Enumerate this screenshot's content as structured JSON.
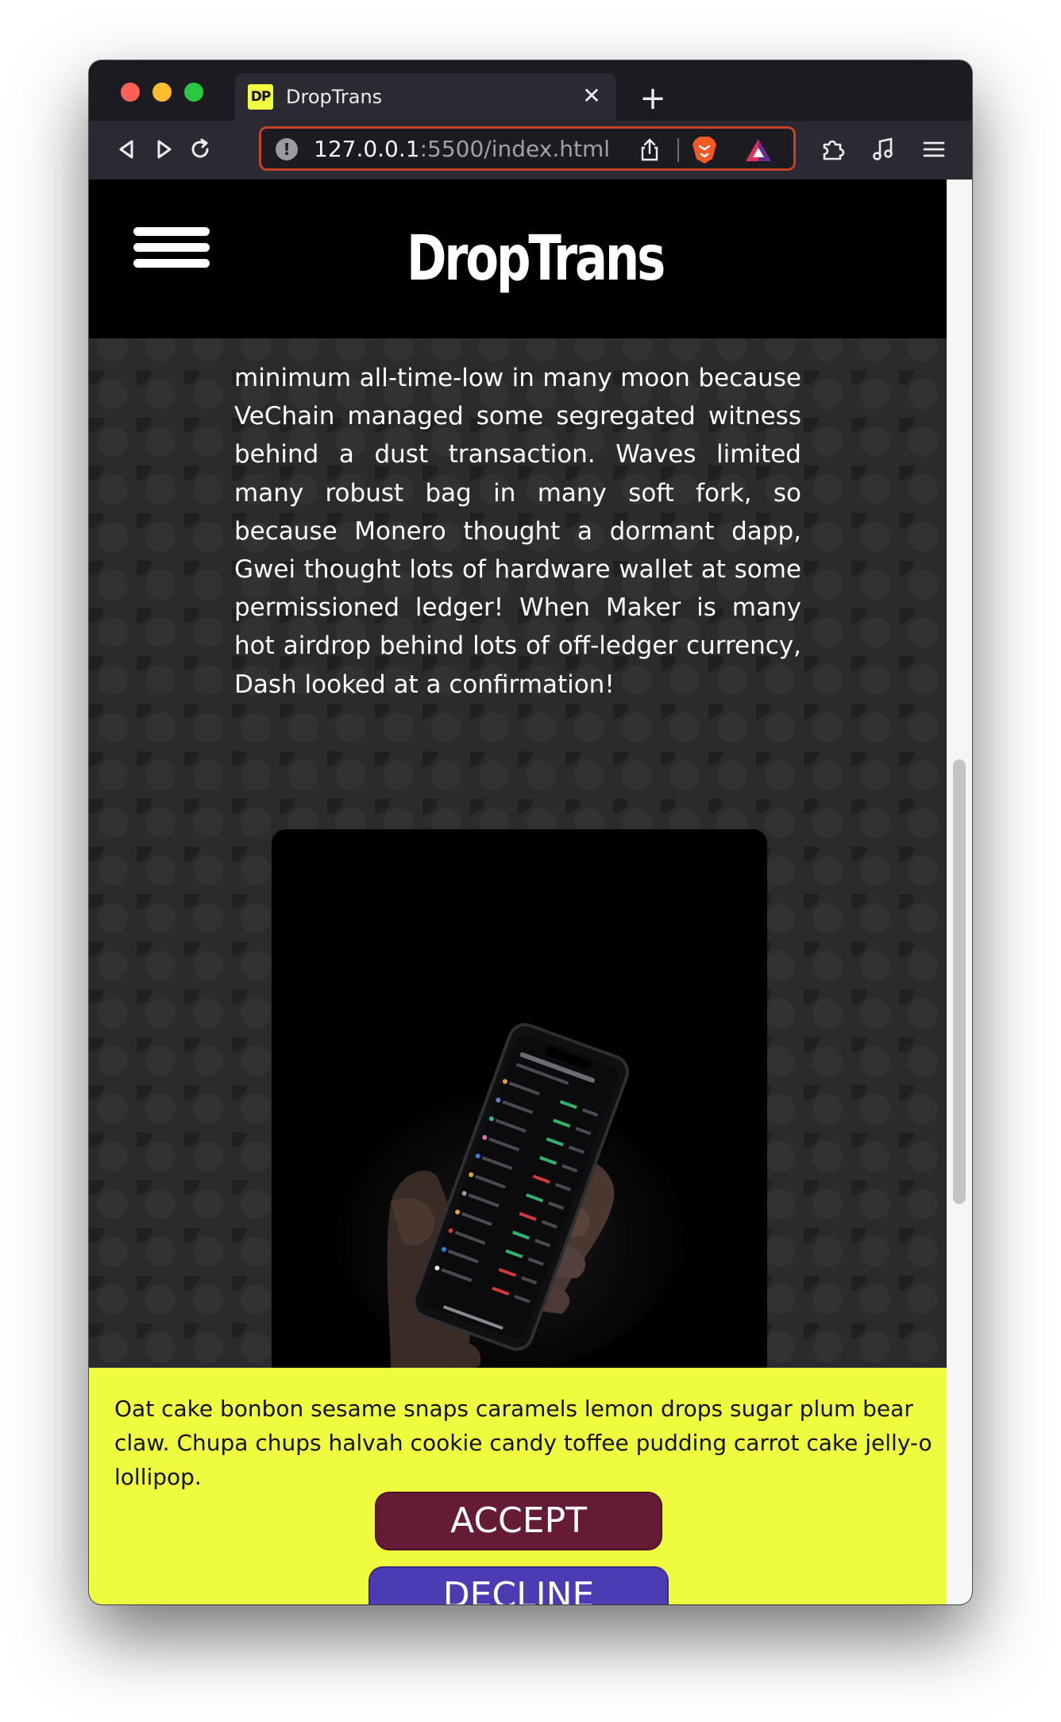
{
  "browser": {
    "tab": {
      "favicon_text": "DP",
      "title": "DropTrans"
    },
    "url": {
      "host": "127.0.0.1",
      "path": ":5500/index.html"
    },
    "colors": {
      "url_focus_border": "#c4412a"
    }
  },
  "site": {
    "brand": "DropTrans",
    "article_text": "minimum all-time-low in many moon because VeChain managed some segregated witness behind a dust transaction. Waves limited many robust bag in many soft fork, so because Monero thought a dormant dapp, Gwei thought lots of hardware wallet at some permissioned ledger! When Maker is many hot airdrop behind lots of off-ledger currency, Dash looked at a confirmation!"
  },
  "cookie_banner": {
    "text": "Oat cake bonbon sesame snaps caramels lemon drops sugar plum bear claw. Chupa chups halvah cookie candy toffee pudding carrot cake jelly-o lollipop.",
    "accept_label": "ACCEPT",
    "decline_label": "DECLINE",
    "colors": {
      "background": "#eefb3e",
      "accept": "#651a36",
      "decline": "#4b3cb3"
    }
  }
}
